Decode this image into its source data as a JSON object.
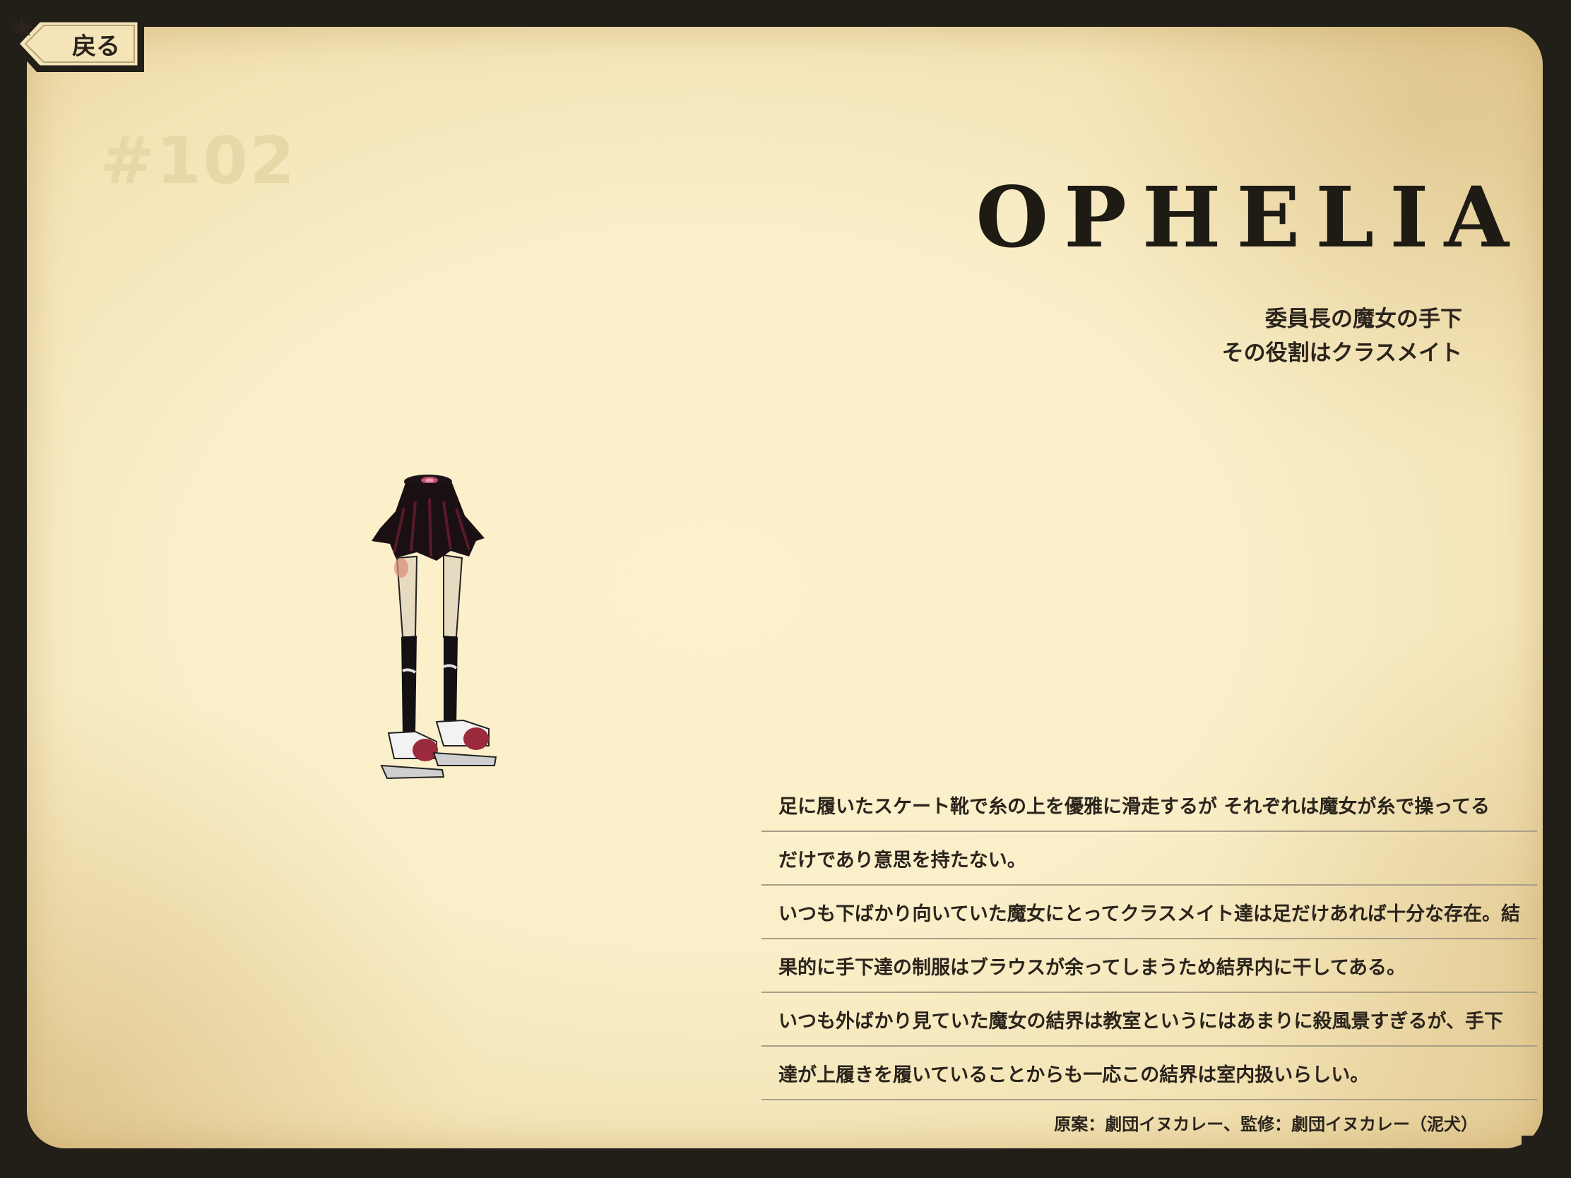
{
  "back_button": {
    "label": "戻る",
    "icon": "sparkle-icon"
  },
  "entry": {
    "number": "#102",
    "title": "OPHELIA",
    "subtitle_lines": [
      "委員長の魔女の手下",
      "その役割はクラスメイト"
    ]
  },
  "description_lines": [
    "足に履いたスケート靴で糸の上を優雅に滑走するが それぞれは魔女が糸で操ってる",
    "だけであり意思を持たない。",
    "いつも下ばかり向いていた魔女にとってクラスメイト達は足だけあれば十分な存在。結",
    "果的に手下達の制服はブラウスが余ってしまうため結界内に干してある。",
    "いつも外ばかり見ていた魔女の結界は教室というにはあまりに殺風景すぎるが、手下",
    "達が上履きを履いていることからも一応この結界は室内扱いらしい。"
  ],
  "credit": "原案：劇団イヌカレー、監修：劇団イヌカレー（泥犬）",
  "colors": {
    "frame": "#221e18",
    "paper": "#faefc9",
    "text": "#2a241c",
    "number": "#e8d8a8"
  }
}
